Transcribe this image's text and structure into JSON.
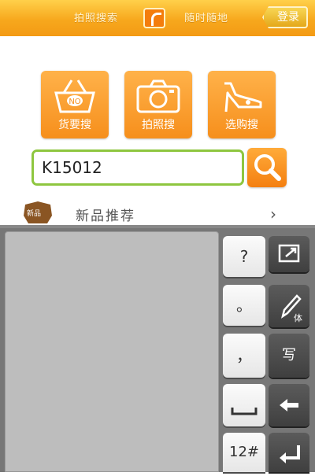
{
  "header": {
    "left_text": "拍照搜索",
    "right_text": "随时随地",
    "login_label": "登录",
    "accent_color": "#f7a81d"
  },
  "tiles": [
    {
      "label": "货要搜",
      "icon": "basket-no-icon"
    },
    {
      "label": "拍照搜",
      "icon": "camera-icon"
    },
    {
      "label": "选购搜",
      "icon": "high-heel-icon"
    }
  ],
  "search": {
    "value": "K15012",
    "button_icon": "magnifier-icon",
    "border_color": "#8ec63f"
  },
  "section": {
    "badge_text": "新品",
    "title": "新品推荐",
    "chevron": "›"
  },
  "keyboard": {
    "keys_light": [
      "?",
      "。",
      "，",
      "",
      "12#"
    ],
    "keys_dark": [
      "",
      "",
      "写",
      "",
      ""
    ],
    "space_key_icon": "space-bar-icon",
    "resize_icon": "resize-icon",
    "handwrite_icon": "pen-icon",
    "backspace_icon": "backspace-icon",
    "enter_icon": "enter-icon"
  }
}
